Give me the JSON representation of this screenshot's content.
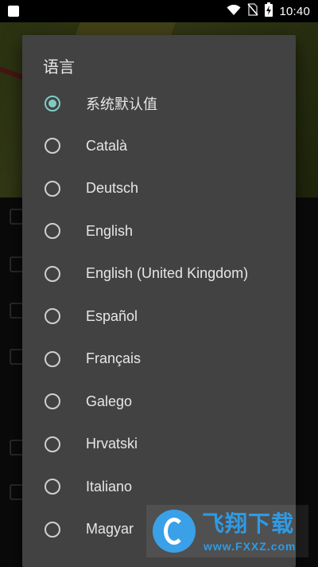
{
  "status_bar": {
    "time": "10:40",
    "icons": [
      "notification-square-icon",
      "wifi-icon",
      "no-sim-icon",
      "battery-charging-icon"
    ]
  },
  "dialog": {
    "title": "语言",
    "selected_index": 0,
    "options": [
      {
        "label": "系统默认值",
        "checked": true
      },
      {
        "label": "Català",
        "checked": false
      },
      {
        "label": "Deutsch",
        "checked": false
      },
      {
        "label": "English",
        "checked": false
      },
      {
        "label": "English (United Kingdom)",
        "checked": false
      },
      {
        "label": "Español",
        "checked": false
      },
      {
        "label": "Français",
        "checked": false
      },
      {
        "label": "Galego",
        "checked": false
      },
      {
        "label": "Hrvatski",
        "checked": false
      },
      {
        "label": "Italiano",
        "checked": false
      },
      {
        "label": "Magyar",
        "checked": false
      }
    ],
    "accent_color": "#7fcbc4",
    "background_color": "#424242"
  },
  "watermark": {
    "text": "飞翔下载",
    "url": "www.FXXZ.com",
    "color": "#2e9be6"
  }
}
